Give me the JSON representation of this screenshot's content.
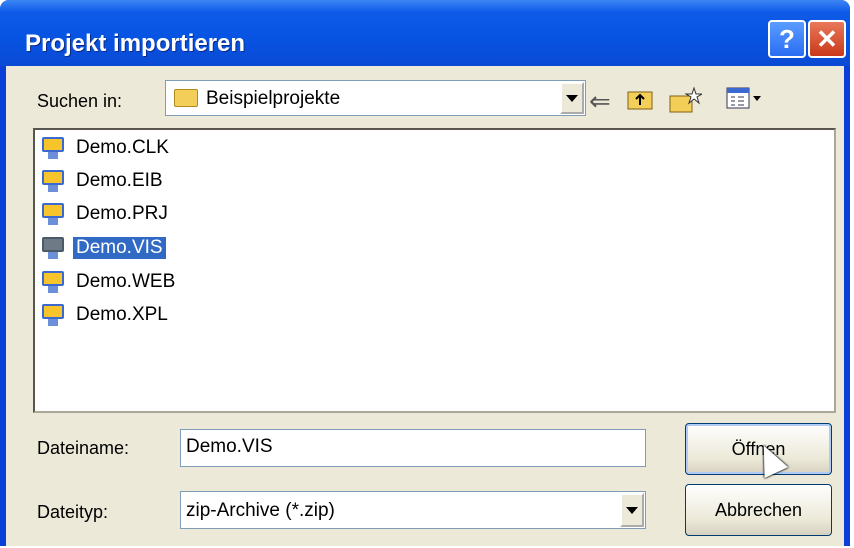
{
  "dialog": {
    "title": "Projekt importieren",
    "help_label": "?",
    "close_label": "✕"
  },
  "look_in": {
    "label": "Suchen in:",
    "value": "Beispielprojekte"
  },
  "toolbar": {
    "back_icon": "back-arrow-icon",
    "up_icon": "up-folder-icon",
    "new_folder_icon": "new-folder-icon",
    "view_menu_icon": "view-menu-icon"
  },
  "files": [
    {
      "name": "Demo.CLK",
      "selected": false
    },
    {
      "name": "Demo.EIB",
      "selected": false
    },
    {
      "name": "Demo.PRJ",
      "selected": false
    },
    {
      "name": "Demo.VIS",
      "selected": true
    },
    {
      "name": "Demo.WEB",
      "selected": false
    },
    {
      "name": "Demo.XPL",
      "selected": false
    }
  ],
  "filename": {
    "label": "Dateiname:",
    "value": "Demo.VIS"
  },
  "filetype": {
    "label": "Dateityp:",
    "value": "zip-Archive (*.zip)"
  },
  "buttons": {
    "open": "Öffnen",
    "cancel": "Abbrechen"
  },
  "colors": {
    "titlebar": "#0754e3",
    "selection": "#316ac5",
    "dialog_bg": "#ece9d8"
  }
}
